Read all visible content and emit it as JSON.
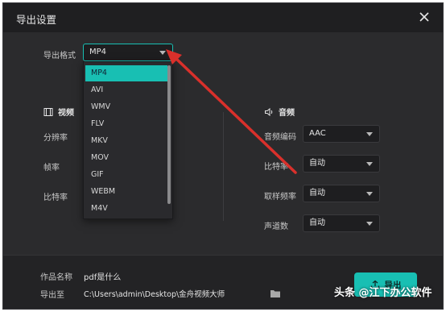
{
  "dialog": {
    "title": "导出设置"
  },
  "format": {
    "label": "导出格式",
    "value": "MP4",
    "options": [
      "MP4",
      "AVI",
      "WMV",
      "FLV",
      "MKV",
      "MOV",
      "GIF",
      "WEBM",
      "M4V"
    ],
    "selected_index": 0
  },
  "video": {
    "title": "视频",
    "rows": [
      {
        "label": "分辨率"
      },
      {
        "label": "帧率"
      },
      {
        "label": "比特率"
      }
    ]
  },
  "audio": {
    "title": "音频",
    "rows": [
      {
        "label": "音频编码",
        "value": "AAC"
      },
      {
        "label": "比特率",
        "value": "自动"
      },
      {
        "label": "取样频率",
        "value": "自动"
      },
      {
        "label": "声道数",
        "value": "自动"
      }
    ]
  },
  "footer": {
    "name_label": "作品名称",
    "name_value": "pdf是什么",
    "path_label": "导出至",
    "path_value": "C:\\Users\\admin\\Desktop\\金舟视频大师",
    "export_label": "导出"
  },
  "watermark": "头条 @江下办公软件",
  "colors": {
    "accent": "#18bfb3",
    "background": "#2b2b2d",
    "titlebar": "#1f1f21",
    "arrow": "#d9302b"
  },
  "icons": {
    "close": "close-icon",
    "caret": "chevron-down-icon",
    "video": "film-icon",
    "audio": "speaker-icon",
    "folder": "folder-icon",
    "export": "upload-icon"
  }
}
